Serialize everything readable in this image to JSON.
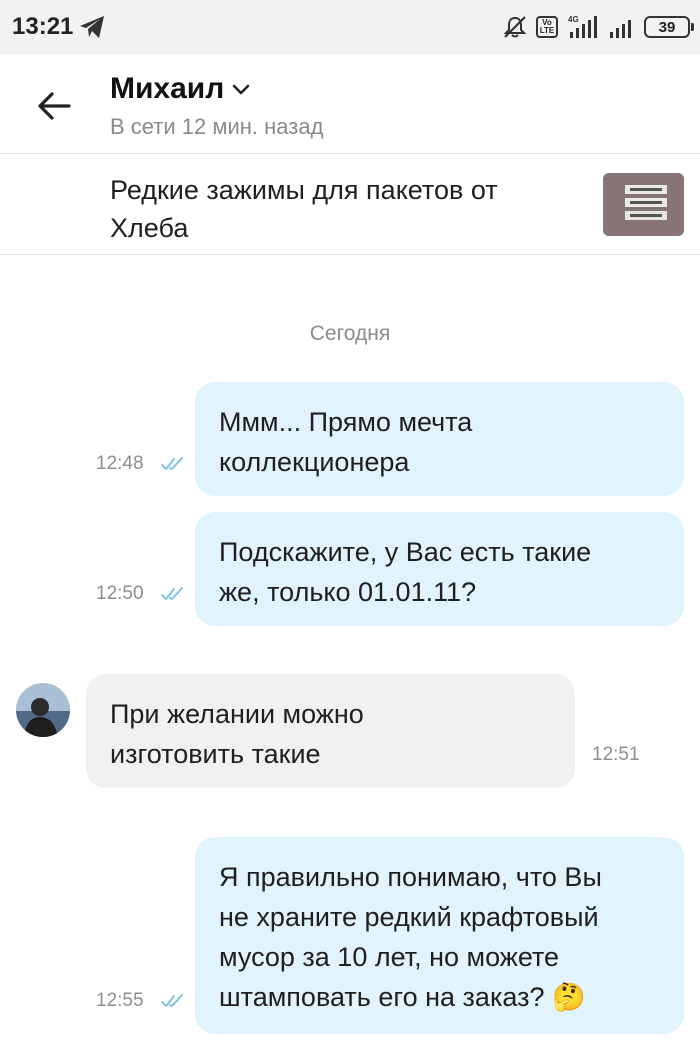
{
  "status_bar": {
    "time": "13:21",
    "battery": "39",
    "network": "4G",
    "volte_top": "Vo",
    "volte_bottom": "LTE"
  },
  "header": {
    "contact_name": "Михаил",
    "contact_status": "В сети 12 мин. назад"
  },
  "ad": {
    "title": "Редкие зажимы для пакетов от Хлеба"
  },
  "chat": {
    "date_separator": "Сегодня",
    "messages": [
      {
        "direction": "out",
        "text_lines": [
          "Ммм... Прямо мечта",
          "коллекционера"
        ],
        "time": "12:48",
        "status": "read"
      },
      {
        "direction": "out",
        "text_lines": [
          "Подскажите, у Вас есть такие",
          "же, только 01.01.11?"
        ],
        "time": "12:50",
        "status": "read"
      },
      {
        "direction": "in",
        "text_lines": [
          "При желании можно",
          "изготовить такие"
        ],
        "time": "12:51"
      },
      {
        "direction": "out",
        "text_lines": [
          "Я правильно понимаю, что Вы",
          "не храните редкий крафтовый",
          "мусор за 10 лет, но можете",
          "штамповать его на заказ? 🤔"
        ],
        "time": "12:55",
        "status": "read"
      }
    ]
  },
  "colors": {
    "outgoing_bubble": "#e1f3fd",
    "incoming_bubble": "#f1f1f1",
    "read_check": "#7ec3e6",
    "status_bar_bg": "#f2f2f2"
  },
  "icons": [
    "telegram-icon",
    "mute-icon",
    "volte-icon",
    "signal-icon",
    "battery-icon",
    "back-arrow-icon",
    "chevron-down-icon",
    "read-check-icon"
  ]
}
